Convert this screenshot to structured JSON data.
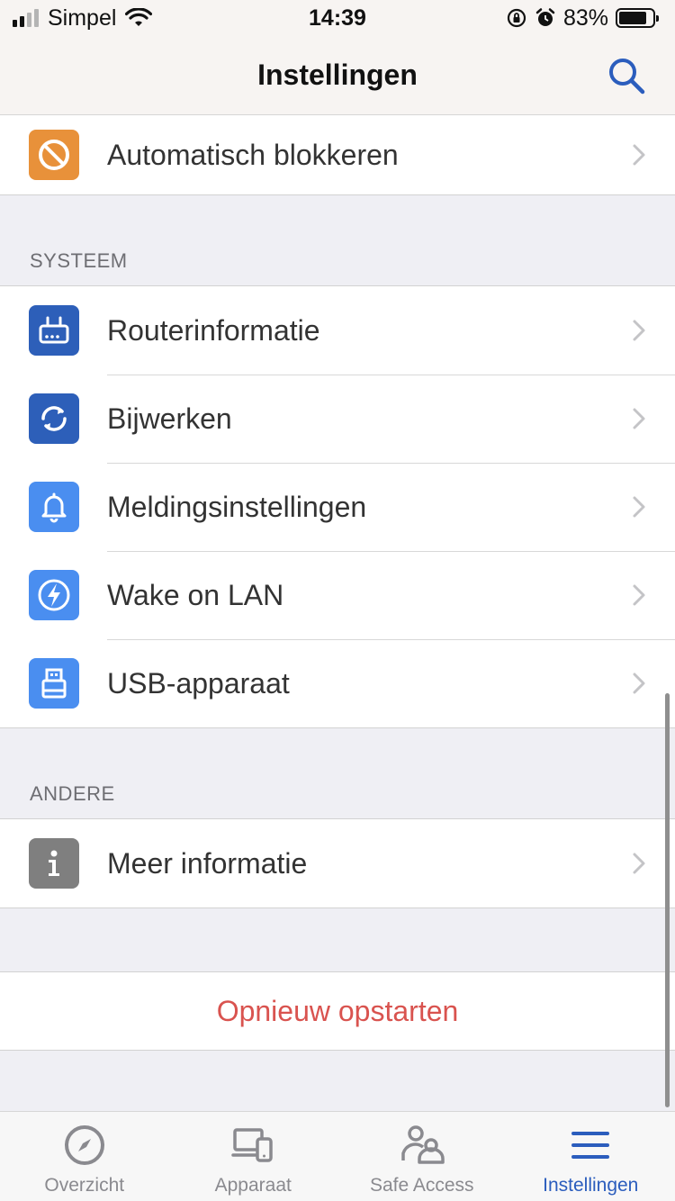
{
  "status_bar": {
    "carrier": "Simpel",
    "time": "14:39",
    "battery": "83%"
  },
  "nav": {
    "title": "Instellingen",
    "search_icon": "search-icon"
  },
  "top_group": {
    "items": [
      {
        "label": "Automatisch blokkeren",
        "icon": "block-icon",
        "color": "#e8913a"
      }
    ]
  },
  "system_section": {
    "header": "SYSTEEM",
    "items": [
      {
        "label": "Routerinformatie",
        "icon": "router-icon",
        "color": "#2d5fb9"
      },
      {
        "label": "Bijwerken",
        "icon": "refresh-icon",
        "color": "#2d5fb9"
      },
      {
        "label": "Meldingsinstellingen",
        "icon": "bell-icon",
        "color": "#4a8ef0"
      },
      {
        "label": "Wake on LAN",
        "icon": "lightning-icon",
        "color": "#4a8ef0"
      },
      {
        "label": "USB-apparaat",
        "icon": "usb-icon",
        "color": "#4a8ef0"
      }
    ]
  },
  "other_section": {
    "header": "ANDERE",
    "items": [
      {
        "label": "Meer informatie",
        "icon": "info-icon",
        "color": "#7f7f7f"
      }
    ]
  },
  "restart": {
    "label": "Opnieuw opstarten",
    "color": "#d9534f"
  },
  "tabs": [
    {
      "label": "Overzicht",
      "icon": "compass-icon",
      "active": false
    },
    {
      "label": "Apparaat",
      "icon": "devices-icon",
      "active": false
    },
    {
      "label": "Safe Access",
      "icon": "users-icon",
      "active": false
    },
    {
      "label": "Instellingen",
      "icon": "menu-icon",
      "active": true
    }
  ],
  "colors": {
    "accent": "#2b5dbd",
    "inactive_tab": "#8a8a8f",
    "destructive": "#d9534f"
  }
}
